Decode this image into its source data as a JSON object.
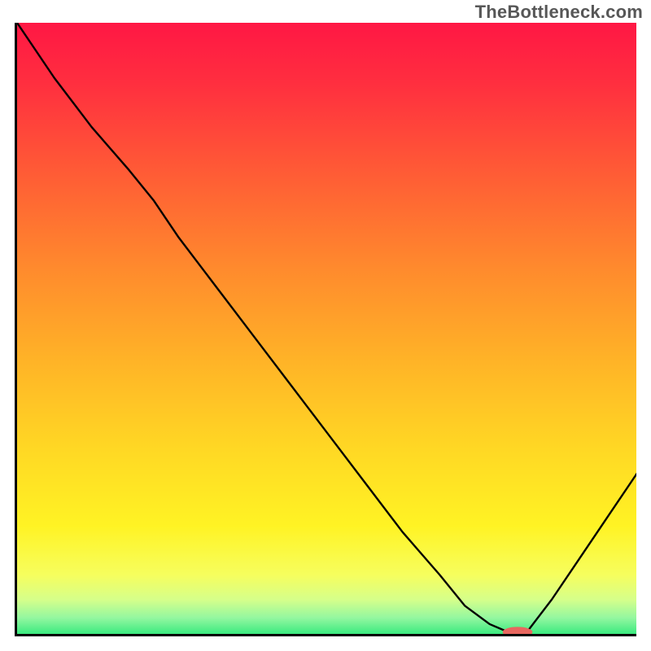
{
  "watermark": "TheBottleneck.com",
  "chart_data": {
    "type": "line",
    "title": "",
    "xlabel": "",
    "ylabel": "",
    "xlim": [
      0,
      100
    ],
    "ylim": [
      0,
      100
    ],
    "grid": false,
    "legend": false,
    "gradient_stops": [
      {
        "offset": 0.0,
        "color": "#ff1744"
      },
      {
        "offset": 0.1,
        "color": "#ff2f3f"
      },
      {
        "offset": 0.25,
        "color": "#ff5d35"
      },
      {
        "offset": 0.4,
        "color": "#ff8a2d"
      },
      {
        "offset": 0.55,
        "color": "#ffb327"
      },
      {
        "offset": 0.7,
        "color": "#ffd924"
      },
      {
        "offset": 0.82,
        "color": "#fff324"
      },
      {
        "offset": 0.9,
        "color": "#f6fe5e"
      },
      {
        "offset": 0.94,
        "color": "#d6ff8a"
      },
      {
        "offset": 0.97,
        "color": "#93f7a0"
      },
      {
        "offset": 1.0,
        "color": "#2ee87a"
      }
    ],
    "series": [
      {
        "name": "curve",
        "stroke": "#000000",
        "stroke_width": 2.4,
        "x": [
          0,
          6,
          12,
          18,
          22,
          26,
          32,
          38,
          44,
          50,
          56,
          62,
          68,
          72,
          76,
          79,
          82,
          86,
          90,
          94,
          100
        ],
        "y": [
          100,
          91,
          83,
          76,
          71,
          65,
          57,
          49,
          41,
          33,
          25,
          17,
          10,
          5,
          2,
          0.7,
          0.7,
          6,
          12,
          18,
          27
        ]
      }
    ],
    "marker": {
      "name": "bottleneck-marker",
      "color": "#e8675f",
      "x_center": 80.5,
      "y_center": 0.7,
      "rx": 2.4,
      "ry": 0.85
    }
  }
}
